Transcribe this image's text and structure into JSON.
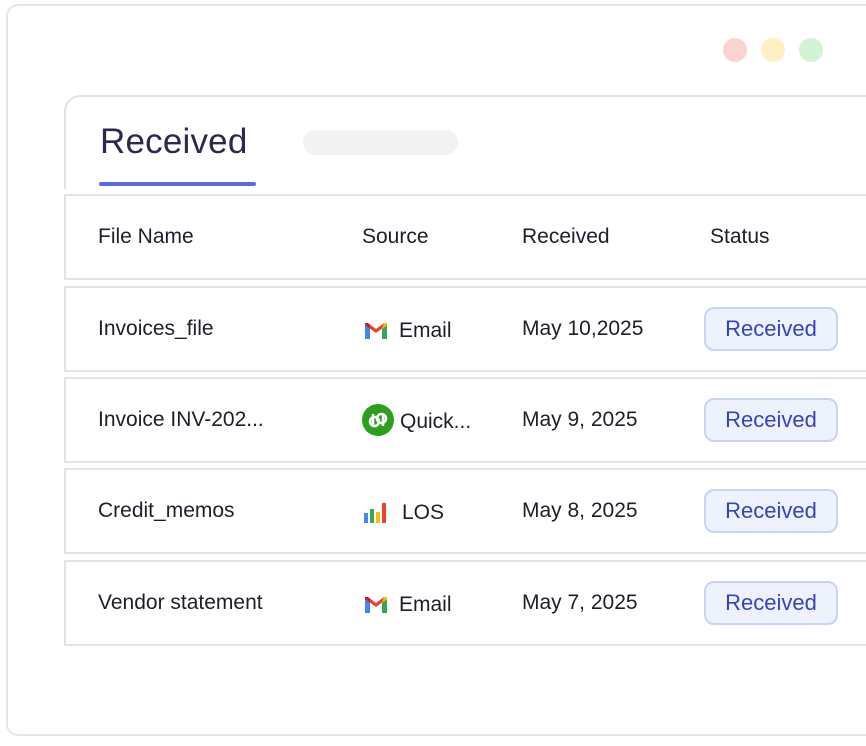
{
  "window": {
    "controls": [
      "close",
      "minimize",
      "maximize"
    ]
  },
  "tabs": {
    "active_label": "Received"
  },
  "table": {
    "headers": {
      "file_name": "File Name",
      "source": "Source",
      "received": "Received",
      "status": "Status"
    },
    "rows": [
      {
        "file_name": "Invoices_file",
        "source": "Email",
        "source_icon": "gmail-icon",
        "received": "May 10,2025",
        "status": "Received"
      },
      {
        "file_name": "Invoice INV-202...",
        "source": "Quick...",
        "source_icon": "quickbooks-icon",
        "received": "May 9, 2025",
        "status": "Received"
      },
      {
        "file_name": "Credit_memos",
        "source": "LOS",
        "source_icon": "bar-chart-icon",
        "received": "May 8, 2025",
        "status": "Received"
      },
      {
        "file_name": "Vendor statement",
        "source": "Email",
        "source_icon": "gmail-icon",
        "received": "May 7, 2025",
        "status": "Received"
      }
    ]
  },
  "colors": {
    "accent": "#5969e3",
    "badge_text": "#3544ba",
    "badge_bg": "#eef2fd",
    "quickbooks_green": "#2ca01c"
  }
}
